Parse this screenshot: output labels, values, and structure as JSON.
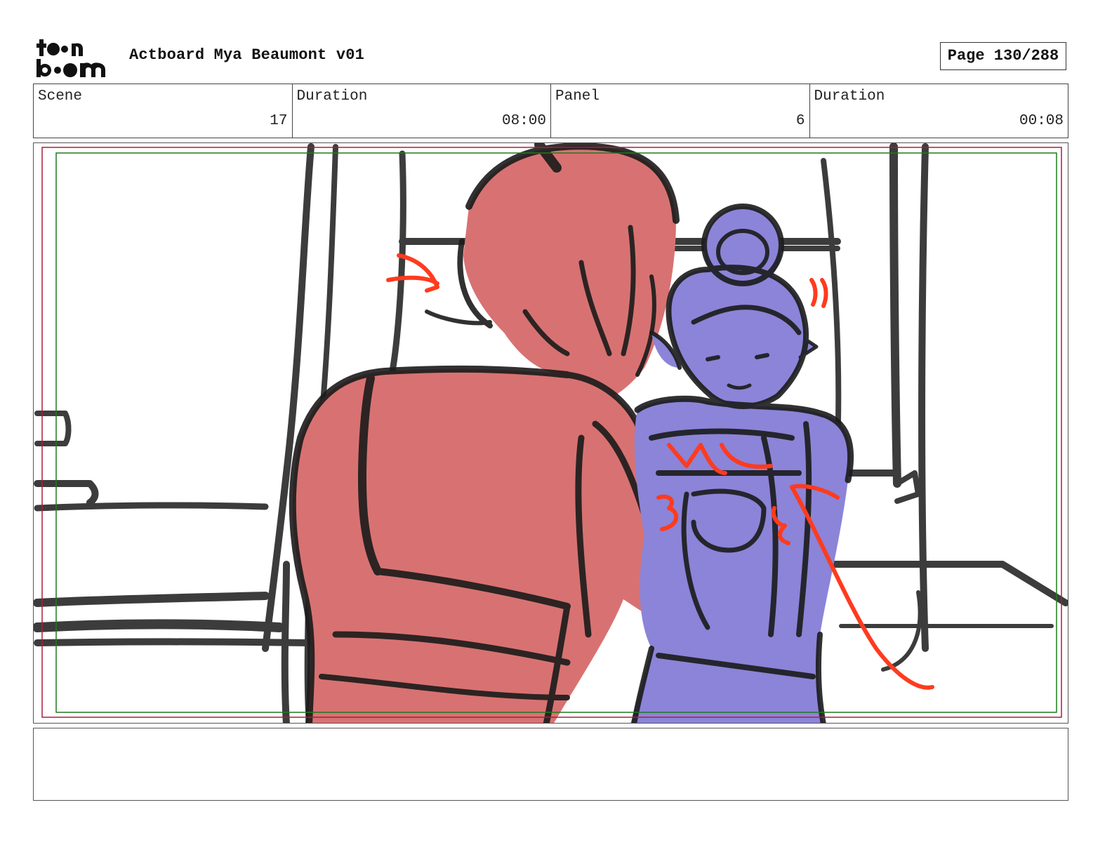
{
  "header": {
    "logo_text": [
      "toon",
      "boom"
    ],
    "title": "Actboard Mya Beaumont v01",
    "page": "Page 130/288"
  },
  "info": {
    "scene": {
      "label": "Scene",
      "value": "17"
    },
    "scene_duration": {
      "label": "Duration",
      "value": "08:00"
    },
    "panel": {
      "label": "Panel",
      "value": "6"
    },
    "panel_duration": {
      "label": "Duration",
      "value": "00:08"
    }
  },
  "colors": {
    "character_left": "#d87272",
    "character_right": "#8b84d8",
    "ink": "#1b1b1b",
    "annotation": "#ff3b1f",
    "safe_frame_outer": "#b01b3a",
    "safe_frame_inner": "#1e7a1e"
  },
  "notes": {
    "text": ""
  }
}
